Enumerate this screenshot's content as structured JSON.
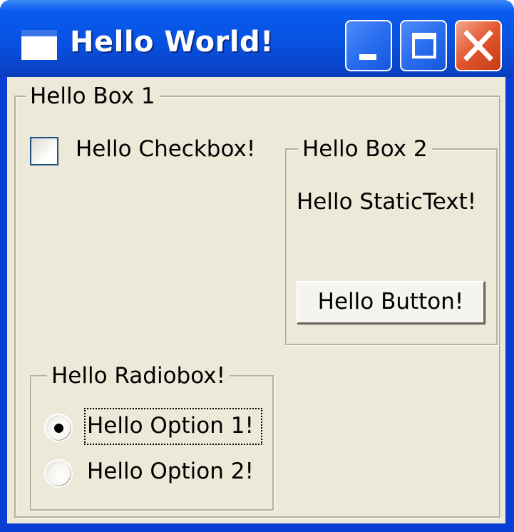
{
  "window": {
    "title": "Hello World!"
  },
  "title_buttons": {
    "minimize": "minimize-icon",
    "maximize": "maximize-icon",
    "close": "close-icon"
  },
  "box1": {
    "label": "Hello Box 1",
    "checkbox": {
      "label": "Hello Checkbox!",
      "checked": false
    }
  },
  "box2": {
    "label": "Hello Box 2",
    "static_text": "Hello StaticText!",
    "button_label": "Hello Button!"
  },
  "radiobox": {
    "label": "Hello Radiobox!",
    "options": [
      {
        "label": "Hello Option 1!",
        "selected": true
      },
      {
        "label": "Hello Option 2!",
        "selected": false
      }
    ]
  }
}
